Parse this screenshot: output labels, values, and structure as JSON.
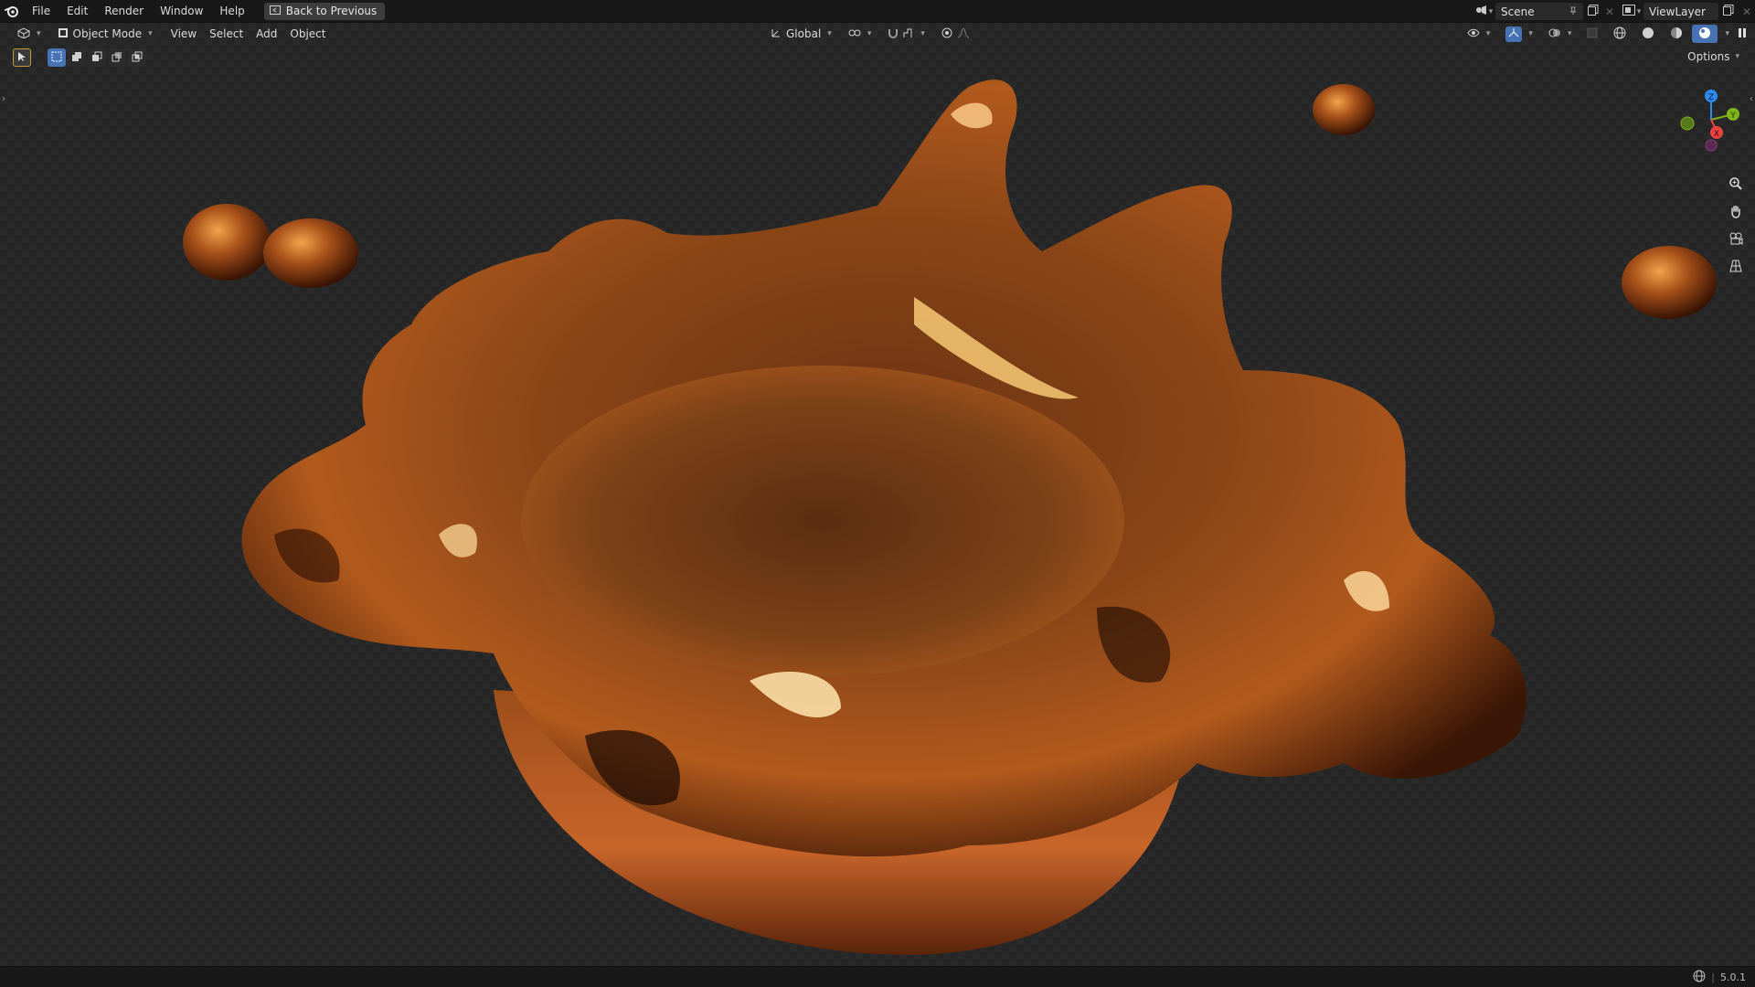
{
  "menubar": {
    "items": [
      "File",
      "Edit",
      "Render",
      "Window",
      "Help"
    ],
    "back_button": "Back to Previous"
  },
  "top_right": {
    "scene": "Scene",
    "view_layer": "ViewLayer"
  },
  "viewport_header": {
    "mode": "Object Mode",
    "menus": [
      "View",
      "Select",
      "Add",
      "Object"
    ],
    "transform_orientation": "Global",
    "options": "Options"
  },
  "gizmo": {
    "z": "Z",
    "y": "Y",
    "x": "X"
  },
  "status": {
    "version": "5.0.1"
  },
  "colors": {
    "accent": "#4772b3",
    "axis_x": "#e8433f",
    "axis_y": "#7fb31a",
    "axis_z": "#2c8af0"
  }
}
